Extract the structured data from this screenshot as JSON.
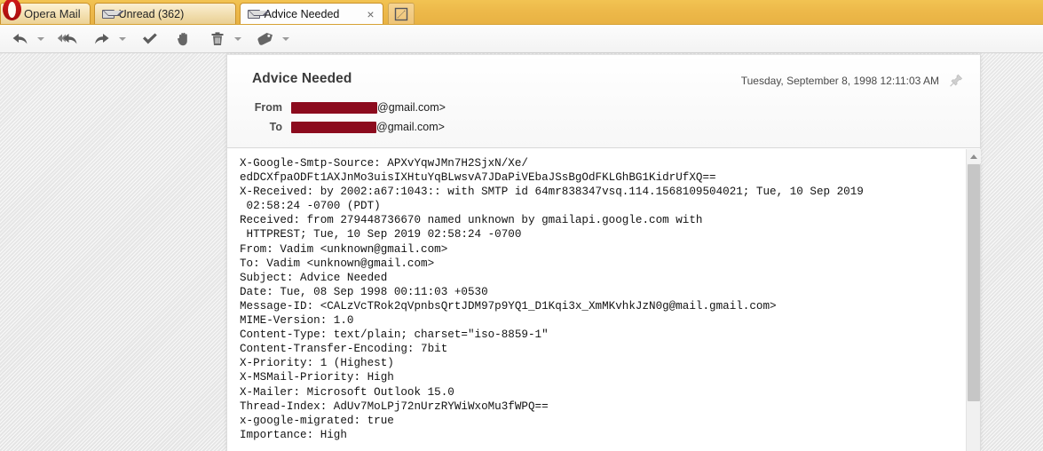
{
  "window": {
    "app_button_label": "Opera Mail"
  },
  "tabs": [
    {
      "label": "Unread (362)",
      "icon": "envelope-icon",
      "active": false,
      "closable": false
    },
    {
      "label": "Advice Needed",
      "icon": "envelope-icon",
      "active": true,
      "closable": true,
      "close_glyph": "×"
    }
  ],
  "compose": {
    "icon": "compose-pencil-icon",
    "title": "Compose new message"
  },
  "toolbar": {
    "buttons": [
      {
        "name": "reply-button",
        "icon": "reply-arrow-icon",
        "has_dropdown": true
      },
      {
        "name": "reply-all-button",
        "icon": "reply-all-arrow-icon",
        "has_dropdown": false
      },
      {
        "name": "forward-button",
        "icon": "forward-arrow-icon",
        "has_dropdown": true
      },
      {
        "name": "mark-read-button",
        "icon": "checkmark-icon",
        "has_dropdown": false
      },
      {
        "name": "mark-spam-button",
        "icon": "hand-stop-icon",
        "has_dropdown": false
      },
      {
        "name": "delete-button",
        "icon": "trash-icon",
        "has_dropdown": true
      },
      {
        "name": "label-button",
        "icon": "tag-label-icon",
        "has_dropdown": true
      }
    ]
  },
  "message": {
    "subject": "Advice Needed",
    "date": "Tuesday, September 8, 1998 12:11:03 AM",
    "pin_icon": "pushpin-icon",
    "from_label": "From",
    "to_label": "To",
    "from_value_suffix": "@gmail.com>",
    "to_value_suffix": "@gmail.com>",
    "redaction_color": "#8c0b1e",
    "raw_headers": [
      "X-Google-Smtp-Source: APXvYqwJMn7H2SjxN/Xe/",
      "edDCXfpaODFt1AXJnMo3uisIXHtuYqBLwsvA7JDaPiVEbaJSsBgOdFKLGhBG1KidrUfXQ==",
      "X-Received: by 2002:a67:1043:: with SMTP id 64mr838347vsq.114.1568109504021; Tue, 10 Sep 2019",
      " 02:58:24 -0700 (PDT)",
      "Received: from 279448736670 named unknown by gmailapi.google.com with",
      " HTTPREST; Tue, 10 Sep 2019 02:58:24 -0700",
      "From: Vadim <unknown@gmail.com>",
      "To: Vadim <unknown@gmail.com>",
      "Subject: Advice Needed",
      "Date: Tue, 08 Sep 1998 00:11:03 +0530",
      "Message-ID: <CALzVcTRok2qVpnbsQrtJDM97p9YQ1_D1Kqi3x_XmMKvhkJzN0g@mail.gmail.com>",
      "MIME-Version: 1.0",
      "Content-Type: text/plain; charset=\"iso-8859-1\"",
      "Content-Transfer-Encoding: 7bit",
      "X-Priority: 1 (Highest)",
      "X-MSMail-Priority: High",
      "X-Mailer: Microsoft Outlook 15.0",
      "Thread-Index: AdUv7MoLPj72nUrzRYWiWxoMu3fWPQ==",
      "x-google-migrated: true",
      "Importance: High"
    ]
  },
  "scrollbar": {
    "up_arrow_icon": "chevron-up-icon",
    "thumb_name": "scrollbar-thumb"
  },
  "colors": {
    "tabbar_accent": "#edb94a",
    "redaction": "#8c0b1e",
    "opera_red": "#d21a1a"
  }
}
